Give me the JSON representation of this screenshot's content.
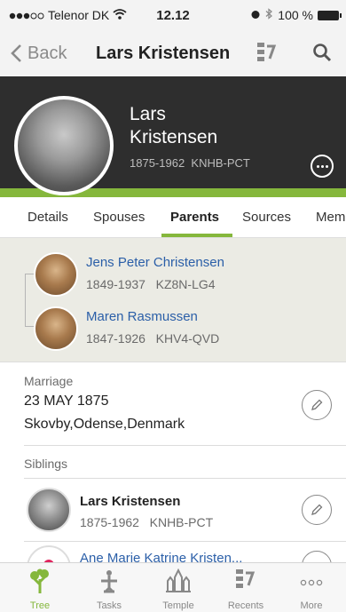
{
  "status_bar": {
    "carrier": "Telenor DK",
    "time": "12.12",
    "battery": "100 %"
  },
  "nav": {
    "back_label": "Back",
    "title": "Lars Kristensen"
  },
  "person": {
    "first_name": "Lars",
    "last_name": "Kristensen",
    "lifespan": "1875-1962",
    "pid": "KNHB-PCT"
  },
  "tabs": [
    "Details",
    "Spouses",
    "Parents",
    "Sources",
    "Mem"
  ],
  "active_tab": "Parents",
  "parents": [
    {
      "name": "Jens Peter Christensen",
      "lifespan": "1849-1937",
      "pid": "KZ8N-LG4"
    },
    {
      "name": "Maren Rasmussen",
      "lifespan": "1847-1926",
      "pid": "KHV4-QVD"
    }
  ],
  "marriage": {
    "label": "Marriage",
    "date": "23 MAY 1875",
    "place": "Skovby,Odense,Denmark"
  },
  "siblings": {
    "label": "Siblings",
    "items": [
      {
        "name": "Lars Kristensen",
        "lifespan": "1875-1962",
        "pid": "KNHB-PCT"
      },
      {
        "name": "Ane Marie Katrine Kristen..."
      }
    ]
  },
  "tabbar": [
    {
      "label": "Tree",
      "icon": "tree-icon",
      "active": true
    },
    {
      "label": "Tasks",
      "icon": "tasks-icon",
      "active": false
    },
    {
      "label": "Temple",
      "icon": "temple-icon",
      "active": false
    },
    {
      "label": "Recents",
      "icon": "recents-icon",
      "active": false
    },
    {
      "label": "More",
      "icon": "more-icon",
      "active": false
    }
  ],
  "colors": {
    "accent_green": "#85b73c",
    "link_blue": "#2b5fa8",
    "hero_bg": "#2e2e2e"
  }
}
